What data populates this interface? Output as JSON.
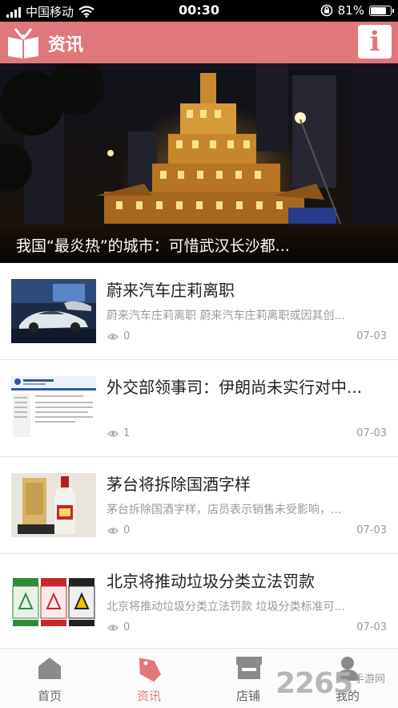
{
  "status_bar": {
    "carrier": "中国移动",
    "time": "00:30",
    "battery": "81%",
    "battery_level": 0.81
  },
  "header": {
    "title": "资讯",
    "info_label": "i"
  },
  "banner": {
    "caption": "我国“最炎热”的城市：可惜武汉长沙都..."
  },
  "news": [
    {
      "title": "蔚来汽车庄莉离职",
      "summary": "蔚来汽车庄莉离职 蔚来汽车庄莉离职或因其创...",
      "views": "0",
      "date": "07-03",
      "thumb_icon": "car-photo"
    },
    {
      "title": "外交部领事司：伊朗尚未实行对中...",
      "summary": "",
      "views": "1",
      "date": "07-03",
      "thumb_icon": "webpage-screenshot"
    },
    {
      "title": "茅台将拆除国酒字样",
      "summary": "茅台拆除国酒字样，店员表示销售未受影响，...",
      "views": "0",
      "date": "07-03",
      "thumb_icon": "moutai-bottle-photo"
    },
    {
      "title": "北京将推动垃圾分类立法罚款",
      "summary": "北京将推动垃圾分类立法罚款 垃圾分类标准可...",
      "views": "0",
      "date": "07-03",
      "thumb_icon": "recycle-bins-photo"
    }
  ],
  "tabs": [
    {
      "label": "首页",
      "icon": "home-icon"
    },
    {
      "label": "资讯",
      "icon": "tag-icon",
      "active": true
    },
    {
      "label": "店铺",
      "icon": "store-icon"
    },
    {
      "label": "我的",
      "icon": "user-icon"
    }
  ],
  "watermark": {
    "number": "2265",
    "text": "手游网"
  },
  "colors": {
    "accent": "#e0787b",
    "text_primary": "#222222",
    "text_secondary": "#999999"
  }
}
